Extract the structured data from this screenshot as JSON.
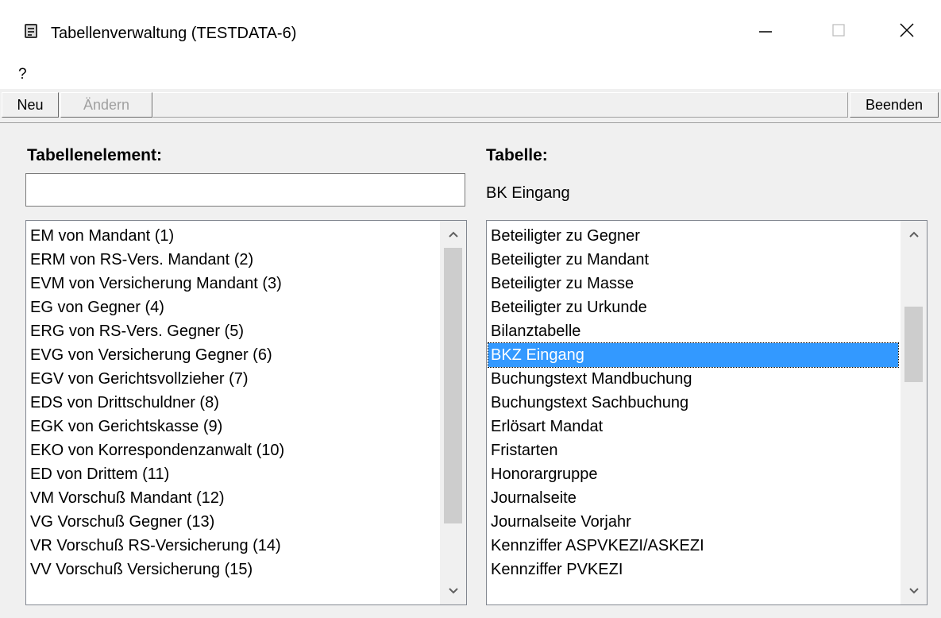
{
  "window": {
    "title": "Tabellenverwaltung (TESTDATA-6)",
    "minimize_glyph": "—",
    "maximize_glyph": "☐",
    "close_glyph": "✕"
  },
  "menu": {
    "items": [
      "?"
    ]
  },
  "toolbar": {
    "new_label": "Neu",
    "edit_label": "Ändern",
    "exit_label": "Beenden"
  },
  "left": {
    "heading": "Tabellenelement:",
    "input_value": "",
    "items": [
      "EM  von Mandant (1)",
      "ERM von RS-Vers. Mandant (2)",
      "EVM von Versicherung Mandant (3)",
      "EG  von Gegner (4)",
      "ERG von RS-Vers. Gegner (5)",
      "EVG von Versicherung Gegner (6)",
      "EGV von Gerichtsvollzieher (7)",
      "EDS von Drittschuldner (8)",
      "EGK von Gerichtskasse (9)",
      "EKO von Korrespondenzanwalt (10)",
      "ED  von Drittem (11)",
      "VM  Vorschuß Mandant (12)",
      "VG  Vorschuß Gegner (13)",
      "VR  Vorschuß RS-Versicherung (14)",
      "VV  Vorschuß Versicherung (15)"
    ]
  },
  "right": {
    "heading": "Tabelle:",
    "selected_table": "BK Eingang",
    "selected_index": 5,
    "items": [
      "Beteiligter zu Gegner",
      "Beteiligter zu Mandant",
      "Beteiligter zu Masse",
      "Beteiligter zu Urkunde",
      "Bilanztabelle",
      "BKZ Eingang",
      "Buchungstext Mandbuchung",
      "Buchungstext Sachbuchung",
      "Erlösart Mandat",
      "Fristarten",
      "Honorargruppe",
      "Journalseite",
      "Journalseite Vorjahr",
      "Kennziffer ASPVKEZI/ASKEZI",
      "Kennziffer PVKEZI"
    ]
  },
  "icons": {
    "app": "app-icon",
    "scroll_up": "chevron-up-icon",
    "scroll_down": "chevron-down-icon"
  },
  "colors": {
    "selection": "#3399ff",
    "window_bg": "#f0f0f0",
    "scroll_thumb": "#cdcdcd"
  }
}
